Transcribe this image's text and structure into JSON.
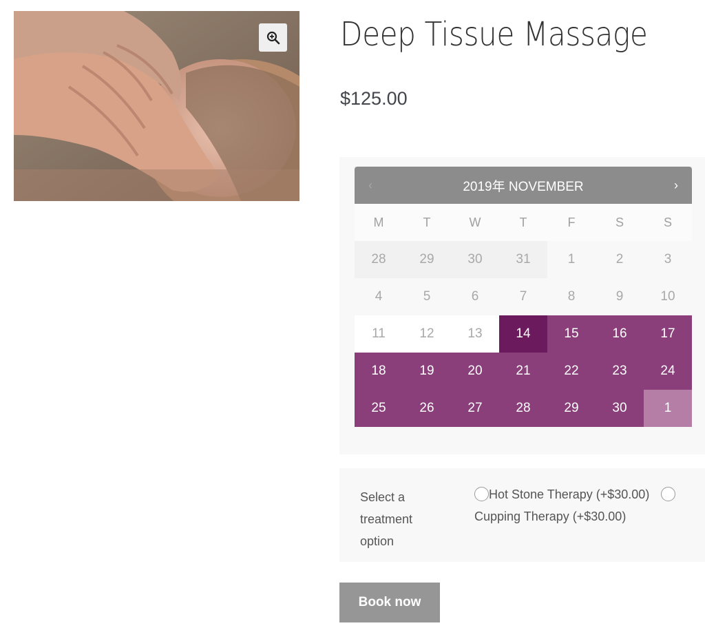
{
  "product": {
    "title": "Deep Tissue Massage",
    "price": "$125.00",
    "image_alt": "massage-photo"
  },
  "icons": {
    "zoom": "zoom-in-icon",
    "prev": "chevron-left-icon",
    "next": "chevron-right-icon",
    "radio": "radio-button-icon"
  },
  "calendar": {
    "title": "2019年 NOVEMBER",
    "prev_label": "‹",
    "next_label": "›",
    "weekdays": [
      "M",
      "T",
      "W",
      "T",
      "F",
      "S",
      "S"
    ],
    "days": [
      {
        "label": "28",
        "state": "other"
      },
      {
        "label": "29",
        "state": "other"
      },
      {
        "label": "30",
        "state": "other"
      },
      {
        "label": "31",
        "state": "other"
      },
      {
        "label": "1",
        "state": "past"
      },
      {
        "label": "2",
        "state": "past"
      },
      {
        "label": "3",
        "state": "past"
      },
      {
        "label": "4",
        "state": "past"
      },
      {
        "label": "5",
        "state": "past"
      },
      {
        "label": "6",
        "state": "past"
      },
      {
        "label": "7",
        "state": "past"
      },
      {
        "label": "8",
        "state": "past"
      },
      {
        "label": "9",
        "state": "past"
      },
      {
        "label": "10",
        "state": "past"
      },
      {
        "label": "11",
        "state": "pastw"
      },
      {
        "label": "12",
        "state": "pastw"
      },
      {
        "label": "13",
        "state": "pastw"
      },
      {
        "label": "14",
        "state": "today"
      },
      {
        "label": "15",
        "state": "avail"
      },
      {
        "label": "16",
        "state": "avail"
      },
      {
        "label": "17",
        "state": "avail"
      },
      {
        "label": "18",
        "state": "avail"
      },
      {
        "label": "19",
        "state": "avail"
      },
      {
        "label": "20",
        "state": "avail"
      },
      {
        "label": "21",
        "state": "avail"
      },
      {
        "label": "22",
        "state": "avail"
      },
      {
        "label": "23",
        "state": "avail"
      },
      {
        "label": "24",
        "state": "avail"
      },
      {
        "label": "25",
        "state": "avail"
      },
      {
        "label": "26",
        "state": "avail"
      },
      {
        "label": "27",
        "state": "avail"
      },
      {
        "label": "28",
        "state": "avail"
      },
      {
        "label": "29",
        "state": "avail"
      },
      {
        "label": "30",
        "state": "avail"
      },
      {
        "label": "1",
        "state": "next"
      }
    ],
    "colors": {
      "header": "#8c8c8c",
      "available": "#8a3f7a",
      "selected": "#6b1a5e",
      "next_month": "#b47ea6"
    }
  },
  "treatment": {
    "label": "Select a treatment option",
    "options": [
      {
        "label": "Hot Stone Therapy (+$30.00)"
      },
      {
        "label": "Cupping Therapy (+$30.00)"
      }
    ]
  },
  "book_button": "Book now"
}
